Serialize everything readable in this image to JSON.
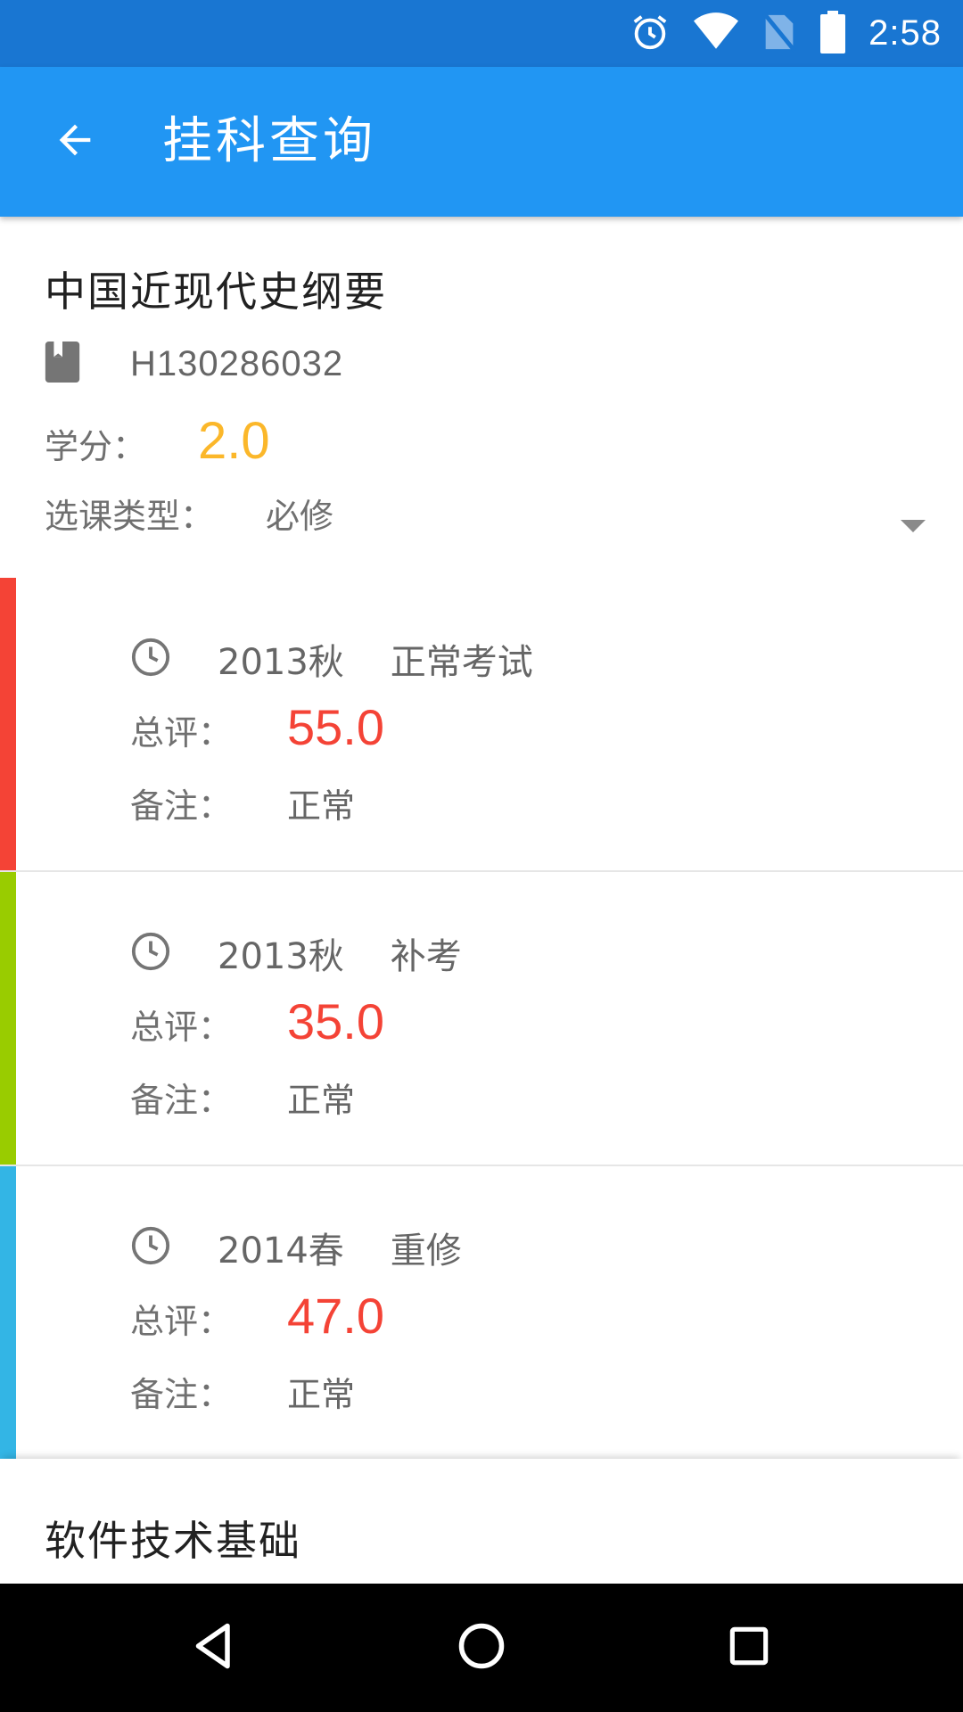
{
  "status_bar": {
    "time": "2:58",
    "icons": [
      "alarm-icon",
      "wifi-icon",
      "no-sim-icon",
      "battery-icon"
    ],
    "background": "#1976d2"
  },
  "app_bar": {
    "title": "挂科查询",
    "back_icon": "arrow-back-icon",
    "background": "#2196f3"
  },
  "course": {
    "name": "中国近现代史纲要",
    "code_icon": "book-icon",
    "code": "H130286032",
    "credit_label": "学分：",
    "credit": "2.0",
    "type_label": "选课类型：",
    "type": "必修",
    "expand_icon": "dropdown-arrow-icon",
    "attempts": [
      {
        "strip_color": "#f44336",
        "term": "2013秋",
        "exam_type": "正常考试",
        "score_label": "总评：",
        "score": "55.0",
        "note_label": "备注：",
        "note": "正常"
      },
      {
        "strip_color": "#99cc00",
        "term": "2013秋",
        "exam_type": "补考",
        "score_label": "总评：",
        "score": "35.0",
        "note_label": "备注：",
        "note": "正常"
      },
      {
        "strip_color": "#33b5e5",
        "term": "2014春",
        "exam_type": "重修",
        "score_label": "总评：",
        "score": "47.0",
        "note_label": "备注：",
        "note": "正常"
      }
    ]
  },
  "next_course": {
    "name": "软件技术基础"
  },
  "nav_bar": {
    "icons": [
      "back-triangle-icon",
      "home-circle-icon",
      "recents-square-icon"
    ]
  },
  "colors": {
    "credit": "#fbb72a",
    "score": "#f44336"
  }
}
